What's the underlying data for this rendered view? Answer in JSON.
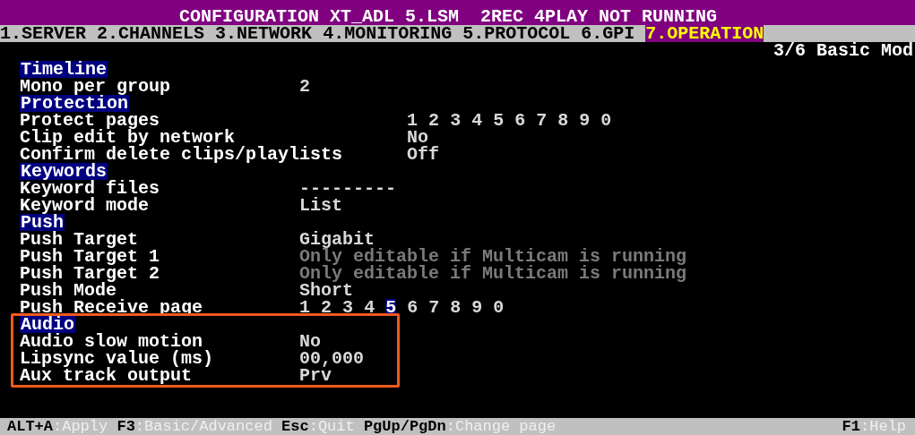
{
  "window": {
    "title": "CONFIGURATION XT_ADL 5.LSM  2REC 4PLAY NOT RUNNING"
  },
  "tabs": [
    {
      "label": "1.SERVER",
      "selected": false
    },
    {
      "label": "2.CHANNELS",
      "selected": false
    },
    {
      "label": "3.NETWORK",
      "selected": false
    },
    {
      "label": "4.MONITORING",
      "selected": false
    },
    {
      "label": "5.PROTOCOL",
      "selected": false
    },
    {
      "label": "6.GPI",
      "selected": false
    },
    {
      "label": "7.OPERATION",
      "selected": true
    }
  ],
  "page_indicator": "3/6 Basic Mod",
  "sections": [
    {
      "title": "Timeline",
      "highlighted": false,
      "rows": [
        {
          "label": "Mono per group",
          "kind": "text",
          "value": "2",
          "disabled": false
        }
      ]
    },
    {
      "title": "Protection",
      "highlighted": false,
      "rows": [
        {
          "label": "Protect pages",
          "kind": "pages",
          "pages": [
            {
              "label": "1",
              "selected": false
            },
            {
              "label": "2",
              "selected": false
            },
            {
              "label": "3",
              "selected": false
            },
            {
              "label": "4",
              "selected": false
            },
            {
              "label": "5",
              "selected": false
            },
            {
              "label": "6",
              "selected": false
            },
            {
              "label": "7",
              "selected": false
            },
            {
              "label": "8",
              "selected": false
            },
            {
              "label": "9",
              "selected": false
            },
            {
              "label": "0",
              "selected": false
            }
          ]
        },
        {
          "label": "Clip edit by network",
          "kind": "text",
          "value": "No",
          "disabled": false
        },
        {
          "label": "Confirm delete clips/playlists",
          "kind": "text",
          "value": "Off",
          "disabled": false
        }
      ]
    },
    {
      "title": "Keywords",
      "highlighted": false,
      "rows": [
        {
          "label": "Keyword files",
          "kind": "text",
          "value": "---------",
          "disabled": false
        },
        {
          "label": "Keyword mode",
          "kind": "text",
          "value": "List",
          "disabled": false
        }
      ]
    },
    {
      "title": "Push",
      "highlighted": false,
      "rows": [
        {
          "label": "Push Target",
          "kind": "text",
          "value": "Gigabit",
          "disabled": false
        },
        {
          "label": "Push Target 1",
          "kind": "text",
          "value": "Only editable if Multicam is running",
          "disabled": true
        },
        {
          "label": "Push Target 2",
          "kind": "text",
          "value": "Only editable if Multicam is running",
          "disabled": true
        },
        {
          "label": "Push Mode",
          "kind": "text",
          "value": "Short",
          "disabled": false
        },
        {
          "label": "Push Receive page",
          "kind": "pages",
          "pages": [
            {
              "label": "1",
              "selected": false
            },
            {
              "label": "2",
              "selected": false
            },
            {
              "label": "3",
              "selected": false
            },
            {
              "label": "4",
              "selected": false
            },
            {
              "label": "5",
              "selected": true
            },
            {
              "label": "6",
              "selected": false
            },
            {
              "label": "7",
              "selected": false
            },
            {
              "label": "8",
              "selected": false
            },
            {
              "label": "9",
              "selected": false
            },
            {
              "label": "0",
              "selected": false
            }
          ]
        }
      ]
    },
    {
      "title": "Audio",
      "highlighted": true,
      "rows": [
        {
          "label": "Audio slow motion",
          "kind": "text",
          "value": "No",
          "disabled": false
        },
        {
          "label": "Lipsync value (ms)",
          "kind": "text",
          "value": "00,000",
          "disabled": false
        },
        {
          "label": "Aux track output",
          "kind": "text",
          "value": "Prv",
          "disabled": false
        }
      ]
    }
  ],
  "status_bar": [
    {
      "key": "ALT+A",
      "action": ":Apply"
    },
    {
      "key": "F3",
      "action": ":Basic/Advanced"
    },
    {
      "key": "Esc",
      "action": ":Quit"
    },
    {
      "key": "PgUp/PgDn",
      "action": ":Change page"
    }
  ],
  "help": {
    "key": "F1",
    "action": ":Help"
  }
}
